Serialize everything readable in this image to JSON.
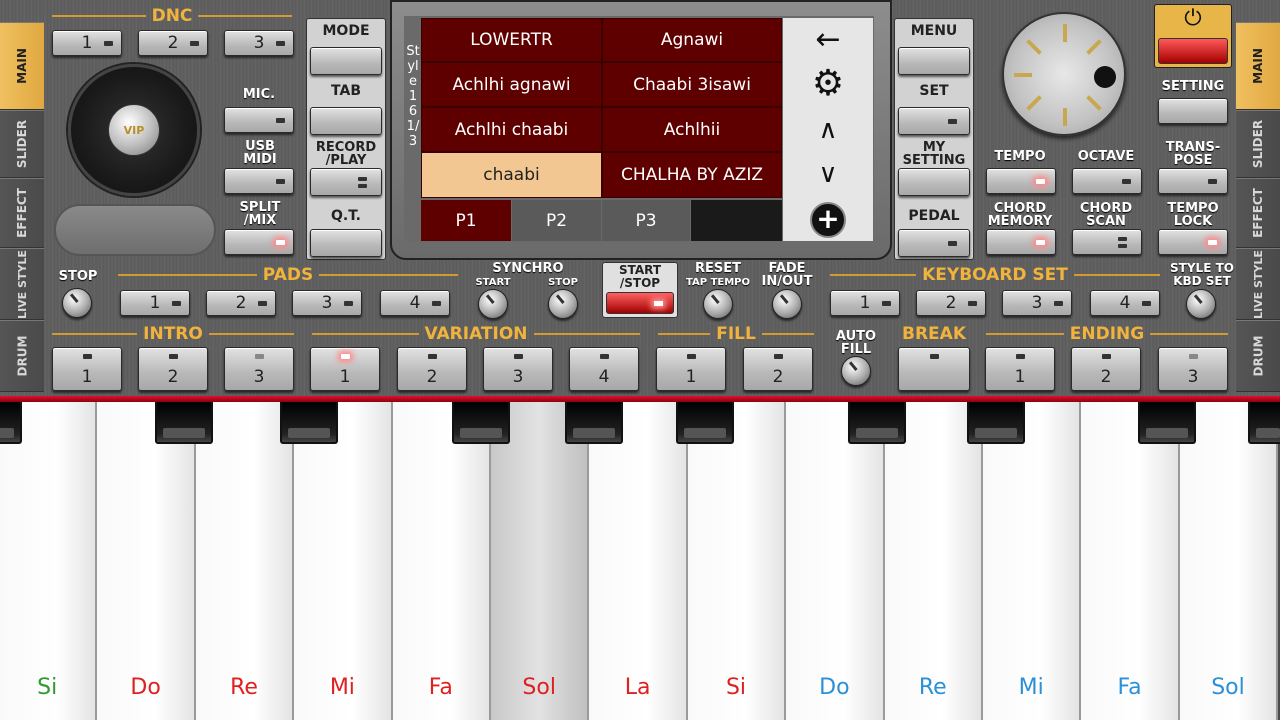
{
  "side_tabs_left": [
    "MAIN",
    "SLIDER",
    "EFFECT",
    "LIVE STYLE",
    "DRUM"
  ],
  "side_tabs_right": [
    "MAIN",
    "SLIDER",
    "EFFECT",
    "LIVE STYLE",
    "DRUM"
  ],
  "dnc": {
    "title": "DNC",
    "buttons": [
      "1",
      "2",
      "3"
    ]
  },
  "vip_label": "VIP",
  "left_labels": {
    "mic": "MIC.",
    "usb": "USB MIDI",
    "split": "SPLIT /MIX"
  },
  "mid_labels": {
    "mode": "MODE",
    "tab": "TAB",
    "record": "RECORD /PLAY",
    "qt": "Q.T."
  },
  "lcd": {
    "side_label": "Style 16 1/3",
    "styles": [
      [
        "LOWERTR",
        "Agnawi"
      ],
      [
        "Achlhi agnawi",
        "Chaabi 3isawi"
      ],
      [
        "Achlhi chaabi",
        "Achlhii"
      ],
      [
        "chaabi",
        "CHALHA BY AZIZ"
      ]
    ],
    "selected": "chaabi",
    "pages": [
      "P1",
      "P2",
      "P3"
    ],
    "nav": {
      "back": "←",
      "settings": "⚙",
      "up": "∧",
      "down": "∨",
      "add": "+"
    }
  },
  "right_labels": {
    "menu": "MENU",
    "set": "SET",
    "my_setting": "MY SETTING",
    "pedal": "PEDAL",
    "setting": "SETTING",
    "tempo": "TEMPO",
    "octave": "OCTAVE",
    "transpose": "TRANS- POSE",
    "chord_memory": "CHORD MEMORY",
    "chord_scan": "CHORD SCAN",
    "tempo_lock": "TEMPO LOCK"
  },
  "pads": {
    "title": "PADS",
    "stop": "STOP",
    "buttons": [
      "1",
      "2",
      "3",
      "4"
    ]
  },
  "synchro": {
    "title": "SYNCHRO",
    "start": "START",
    "stop": "STOP"
  },
  "start_stop": "START /STOP",
  "reset": {
    "title": "RESET",
    "sub": "TAP TEMPO"
  },
  "fade": "FADE IN/OUT",
  "keyboard_set": {
    "title": "KEYBOARD SET",
    "buttons": [
      "1",
      "2",
      "3",
      "4"
    ],
    "style_to": "STYLE TO KBD SET"
  },
  "sections": {
    "intro": "INTRO",
    "variation": "VARIATION",
    "fill": "FILL",
    "auto_fill": "AUTO FILL",
    "break": "BREAK",
    "ending": "ENDING"
  },
  "intro_buttons": [
    "1",
    "2",
    "3"
  ],
  "variation_buttons": [
    "1",
    "2",
    "3",
    "4"
  ],
  "fill_buttons": [
    "1",
    "2"
  ],
  "ending_buttons": [
    "1",
    "2",
    "3"
  ],
  "keys": [
    {
      "note": "Si",
      "color": "#2e9a2e"
    },
    {
      "note": "Do",
      "color": "#e02020"
    },
    {
      "note": "Re",
      "color": "#e02020"
    },
    {
      "note": "Mi",
      "color": "#e02020"
    },
    {
      "note": "Fa",
      "color": "#e02020"
    },
    {
      "note": "Sol",
      "color": "#e02020"
    },
    {
      "note": "La",
      "color": "#e02020"
    },
    {
      "note": "Si",
      "color": "#e02020"
    },
    {
      "note": "Do",
      "color": "#2a90d8"
    },
    {
      "note": "Re",
      "color": "#2a90d8"
    },
    {
      "note": "Mi",
      "color": "#2a90d8"
    },
    {
      "note": "Fa",
      "color": "#2a90d8"
    },
    {
      "note": "Sol",
      "color": "#2a90d8"
    }
  ],
  "pressed_key": "Sol",
  "colors": {
    "accent": "#f0b33c",
    "lcd_bg": "#5e0000",
    "lcd_selected": "#f3c792",
    "led_on": "#ff8a8a",
    "key_strip": "#c8102e"
  }
}
